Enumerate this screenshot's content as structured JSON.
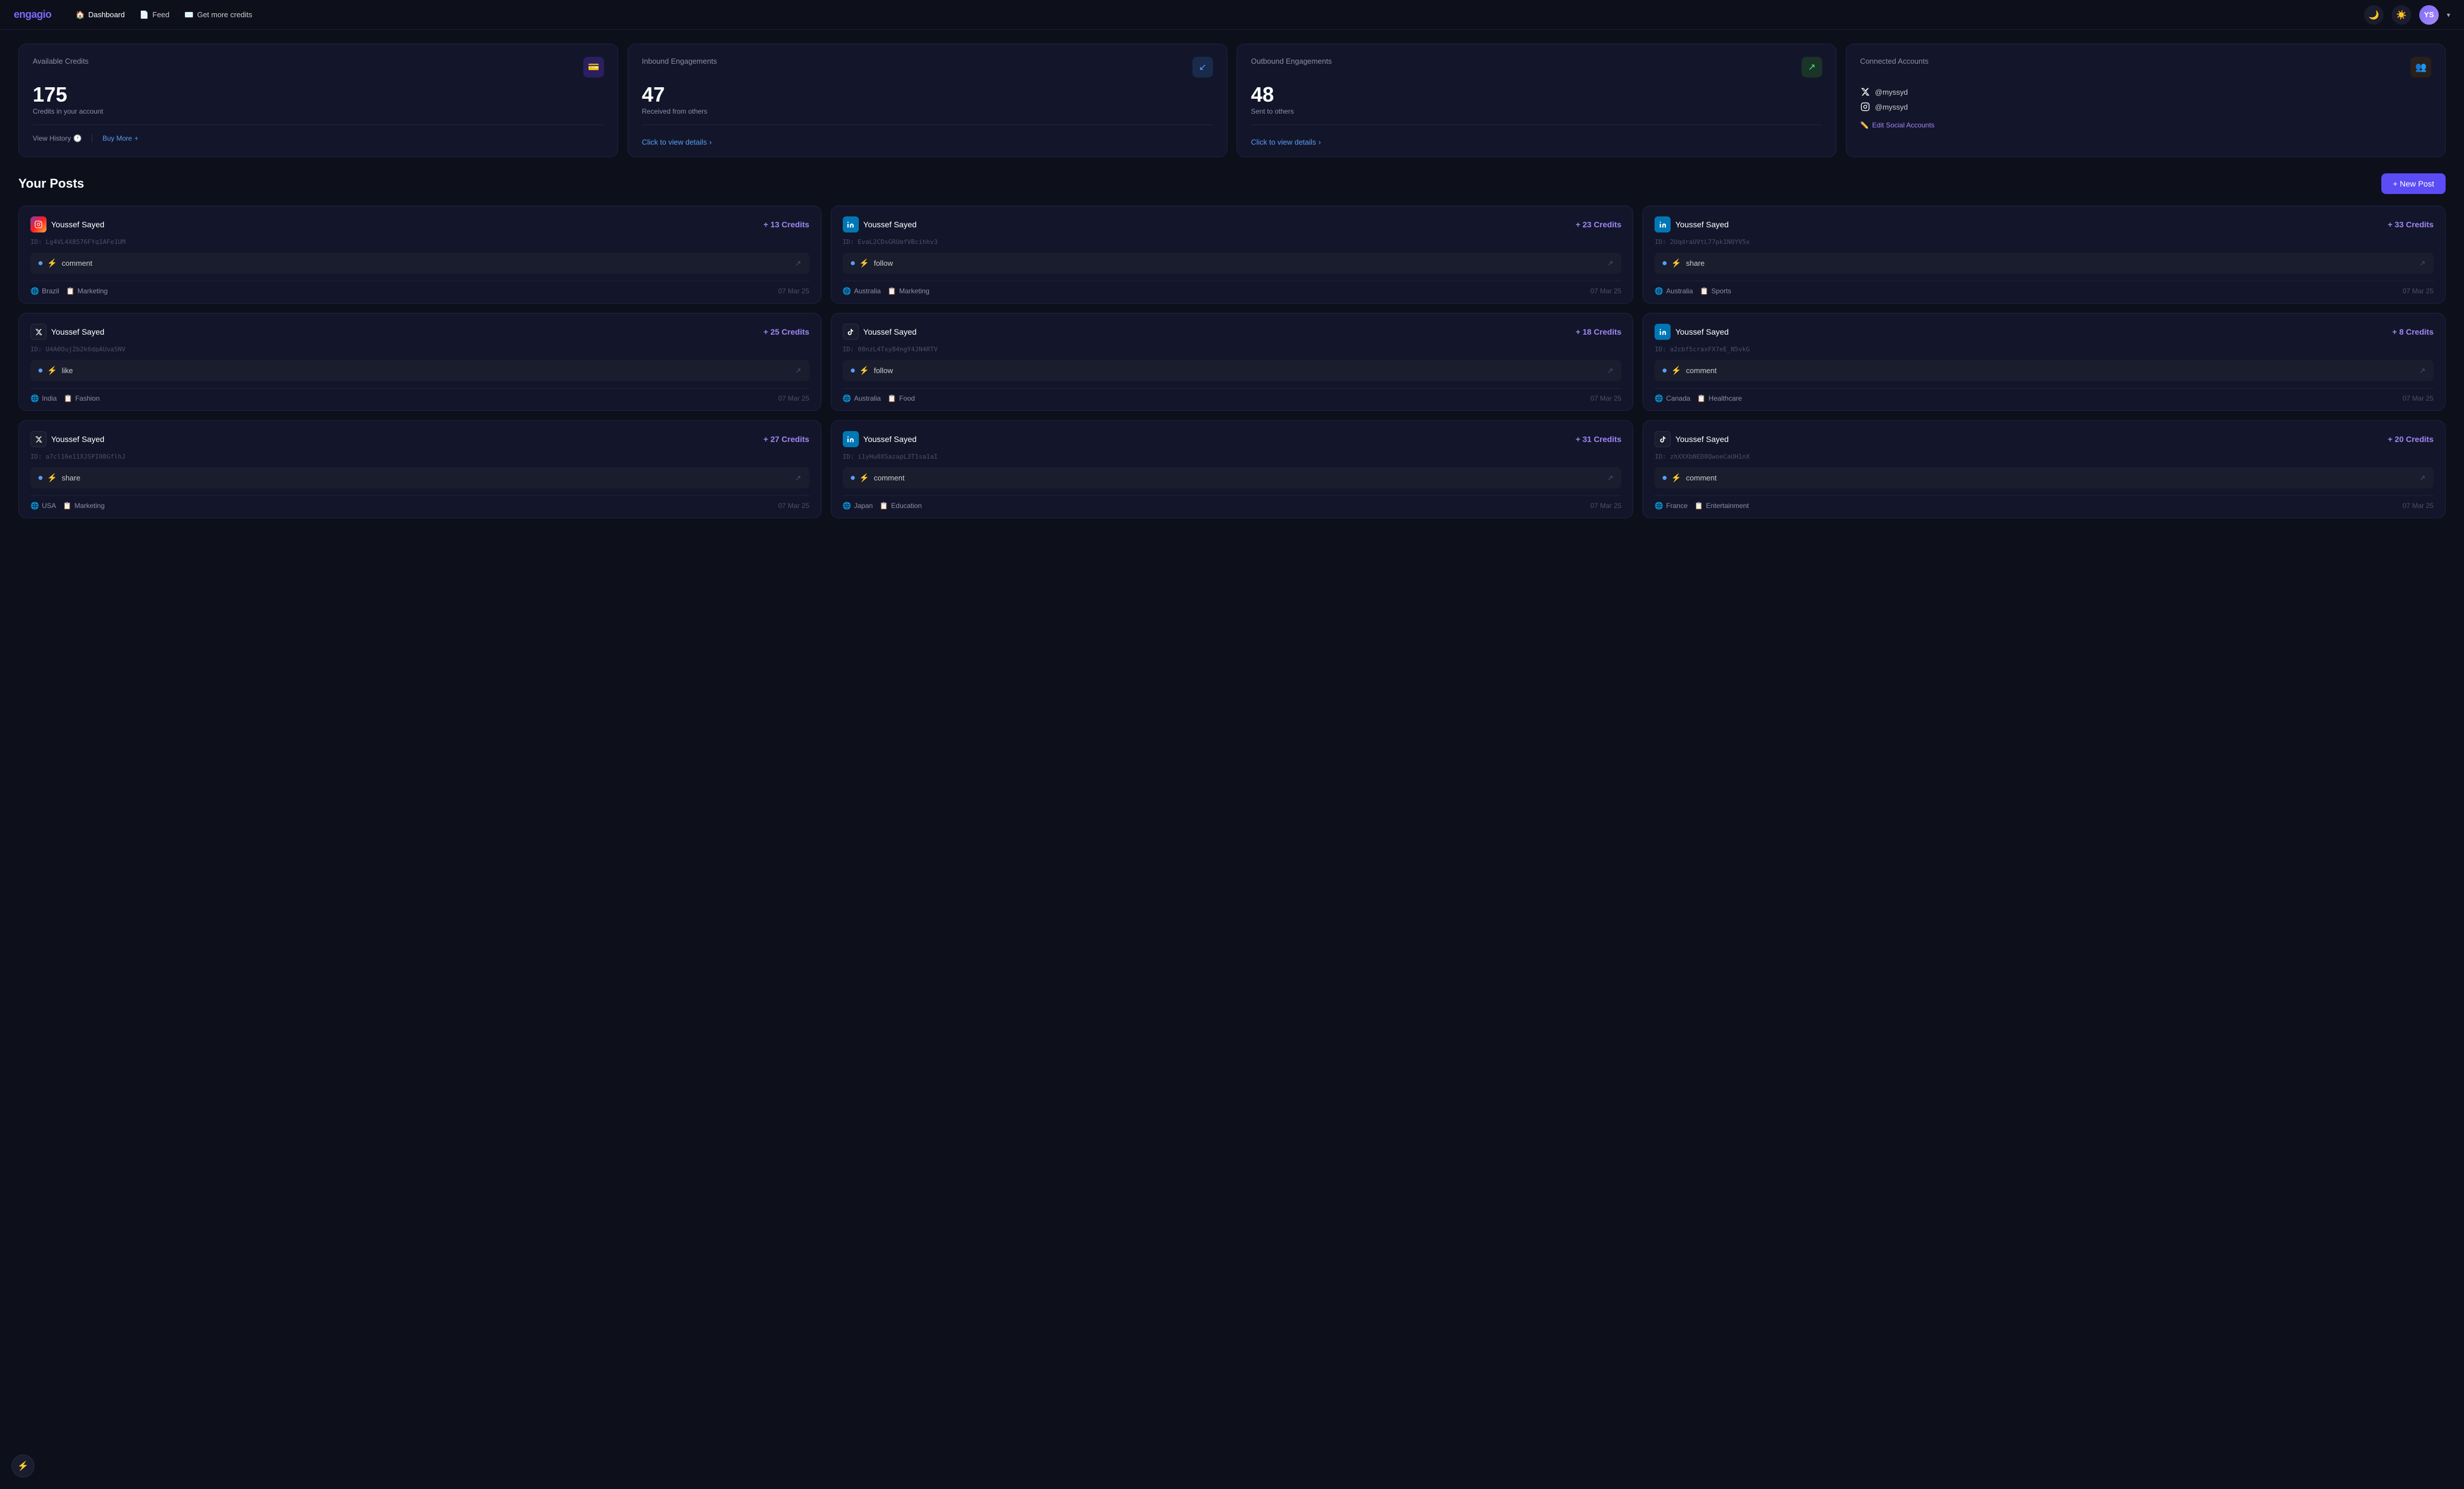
{
  "nav": {
    "logo": "engagio",
    "links": [
      {
        "id": "dashboard",
        "label": "Dashboard",
        "icon": "🏠",
        "active": true
      },
      {
        "id": "feed",
        "label": "Feed",
        "icon": "📄"
      },
      {
        "id": "get-credits",
        "label": "Get more credits",
        "icon": "✉️"
      }
    ]
  },
  "stats": {
    "available_credits": {
      "title": "Available Credits",
      "value": "175",
      "sub": "Credits in your account",
      "view_history": "View History",
      "buy_more": "Buy More",
      "icon": "💳",
      "icon_class": "stat-icon-purple"
    },
    "inbound": {
      "title": "Inbound Engagements",
      "value": "47",
      "sub": "Received from others",
      "click_text": "Click to view details",
      "icon": "↙",
      "icon_class": "stat-icon-blue"
    },
    "outbound": {
      "title": "Outbound Engagements",
      "value": "48",
      "sub": "Sent to others",
      "click_text": "Click to view details",
      "icon": "↗",
      "icon_class": "stat-icon-green"
    },
    "connected": {
      "title": "Connected Accounts",
      "accounts": [
        {
          "platform": "twitter",
          "handle": "@myssyd"
        },
        {
          "platform": "instagram",
          "handle": "@myssyd"
        }
      ],
      "edit_label": "Edit Social Accounts",
      "icon": "👥",
      "icon_class": "stat-icon-orange"
    }
  },
  "posts_section": {
    "title": "Your Posts",
    "new_post_label": "+ New Post"
  },
  "posts": [
    {
      "id": 1,
      "platform": "instagram",
      "user": "Youssef Sayed",
      "post_id": "ID: Lg4VL4X8576FYq1AFe1UM",
      "credits": "+ 13 Credits",
      "action": "comment",
      "country": "Brazil",
      "category": "Marketing",
      "date": "07 Mar 25"
    },
    {
      "id": 2,
      "platform": "linkedin",
      "user": "Youssef Sayed",
      "post_id": "ID: EvaL2CDsGRUmfVBcihhv3",
      "credits": "+ 23 Credits",
      "action": "follow",
      "country": "Australia",
      "category": "Marketing",
      "date": "07 Mar 25"
    },
    {
      "id": 3,
      "platform": "linkedin",
      "user": "Youssef Sayed",
      "post_id": "ID: 2UqdraUVtL77pk1N0YV5x",
      "credits": "+ 33 Credits",
      "action": "share",
      "country": "Australia",
      "category": "Sports",
      "date": "07 Mar 25"
    },
    {
      "id": 4,
      "platform": "twitter",
      "user": "Youssef Sayed",
      "post_id": "ID: U4A0OujZb2k6dpAUva5NV",
      "credits": "+ 25 Credits",
      "action": "like",
      "country": "India",
      "category": "Fashion",
      "date": "07 Mar 25"
    },
    {
      "id": 5,
      "platform": "tiktok",
      "user": "Youssef Sayed",
      "post_id": "ID: 08nzL4Txy84ngY4JN4RTV",
      "credits": "+ 18 Credits",
      "action": "follow",
      "country": "Australia",
      "category": "Food",
      "date": "07 Mar 25"
    },
    {
      "id": 6,
      "platform": "linkedin",
      "user": "Youssef Sayed",
      "post_id": "ID: a2cbf5craxFX7eE_N5vkG",
      "credits": "+ 8 Credits",
      "action": "comment",
      "country": "Canada",
      "category": "Healthcare",
      "date": "07 Mar 25"
    },
    {
      "id": 7,
      "platform": "twitter",
      "user": "Youssef Sayed",
      "post_id": "ID: a7cl16e11XJSPI08GflhJ",
      "credits": "+ 27 Credits",
      "action": "share",
      "country": "USA",
      "category": "Marketing",
      "date": "07 Mar 25"
    },
    {
      "id": 8,
      "platform": "linkedin",
      "user": "Youssef Sayed",
      "post_id": "ID: i1yHu0XSazapL3T1sa1aI",
      "credits": "+ 31 Credits",
      "action": "comment",
      "country": "Japan",
      "category": "Education",
      "date": "07 Mar 25"
    },
    {
      "id": 9,
      "platform": "tiktok",
      "user": "Youssef Sayed",
      "post_id": "ID: zhXXXbNED8QwoeCaUH1nX",
      "credits": "+ 20 Credits",
      "action": "comment",
      "country": "France",
      "category": "Entertainment",
      "date": "07 Mar 25"
    }
  ]
}
